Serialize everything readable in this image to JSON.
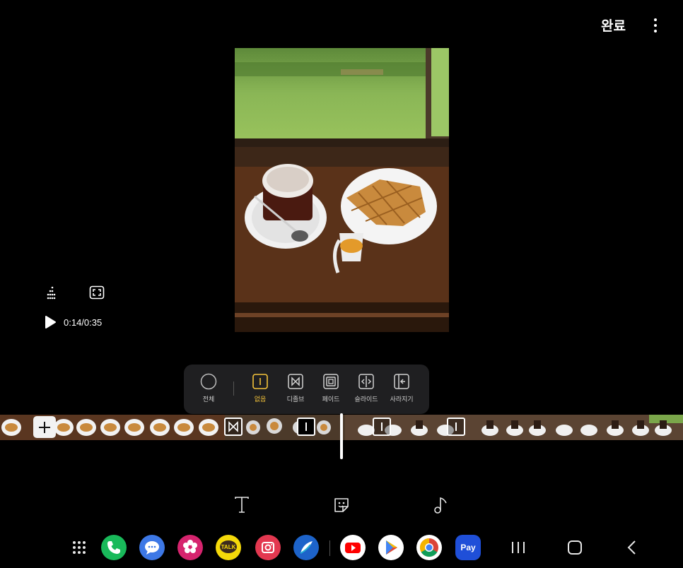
{
  "header": {
    "done_label": "완료",
    "more_icon": "more-vert-icon"
  },
  "preview": {
    "image": "photo-coffee-waffle",
    "description_icon": "photo"
  },
  "player": {
    "time": "0:14/0:35",
    "play_icon": "play-icon",
    "audio_icon": "audio-levels-icon",
    "aspect_icon": "aspect-ratio-icon"
  },
  "transitions": {
    "items": [
      {
        "label": "전체",
        "icon": "circle-icon"
      },
      {
        "label": "없음",
        "icon": "transition-none-icon",
        "active": true
      },
      {
        "label": "디졸브",
        "icon": "dissolve-icon"
      },
      {
        "label": "페이드",
        "icon": "fade-icon"
      },
      {
        "label": "슬라이드",
        "icon": "slide-icon"
      },
      {
        "label": "사라지기",
        "icon": "wipe-icon"
      }
    ]
  },
  "edit_tools": [
    {
      "name": "text-tool",
      "icon": "text-icon"
    },
    {
      "name": "sticker-tool",
      "icon": "sticker-icon"
    },
    {
      "name": "music-tool",
      "icon": "music-note-icon"
    }
  ],
  "dock": {
    "apps": [
      "app-drawer",
      "phone",
      "messages",
      "gallery",
      "kakaotalk",
      "camera",
      "bixby",
      "youtube",
      "play-store",
      "chrome",
      "samsung-pay"
    ],
    "pay_label": "Pay",
    "talk_label": "TALK"
  },
  "nav": [
    "recents",
    "home",
    "back"
  ]
}
